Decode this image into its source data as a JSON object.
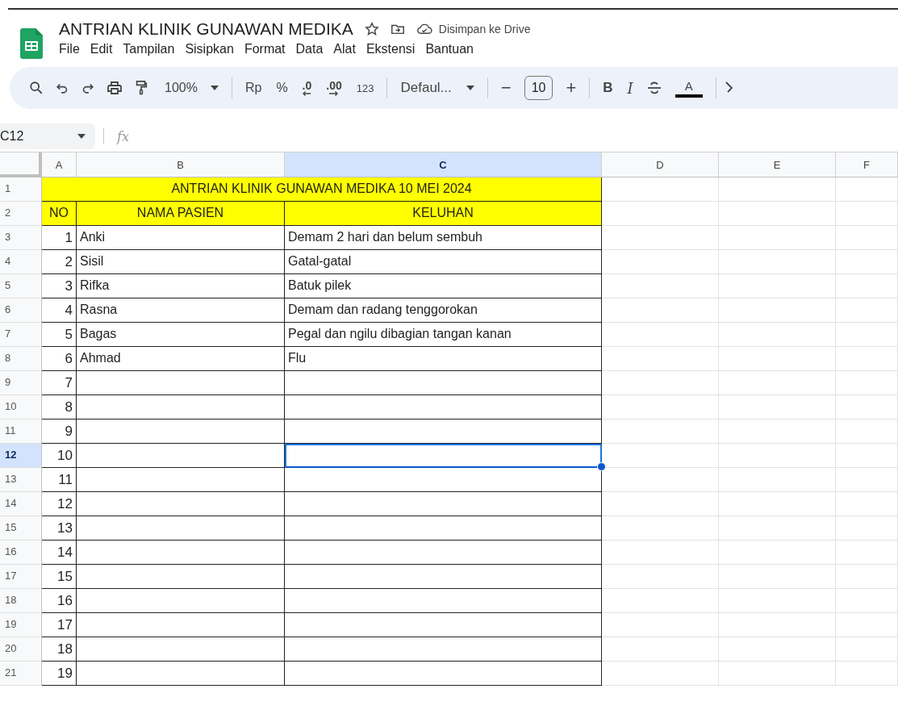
{
  "document": {
    "title": "ANTRIAN KLINIK GUNAWAN MEDIKA",
    "save_status": "Disimpan ke Drive"
  },
  "menu": [
    "File",
    "Edit",
    "Tampilan",
    "Sisipkan",
    "Format",
    "Data",
    "Alat",
    "Ekstensi",
    "Bantuan"
  ],
  "toolbar": {
    "zoom": "100%",
    "currency": "Rp",
    "percent": "%",
    "decrease_decimal": ".0",
    "increase_decimal": ".00",
    "number_format": "123",
    "font": "Defaul...",
    "minus": "−",
    "font_size": "10",
    "plus": "+",
    "bold": "B",
    "italic": "I",
    "text_color": "A"
  },
  "name_box": "C12",
  "formula_label": "fx",
  "columns": [
    {
      "label": "A",
      "selected": false
    },
    {
      "label": "B",
      "selected": false
    },
    {
      "label": "C",
      "selected": true
    },
    {
      "label": "D",
      "selected": false
    },
    {
      "label": "E",
      "selected": false
    },
    {
      "label": "F",
      "selected": false
    }
  ],
  "rows": [
    {
      "number": "1",
      "selected": false,
      "kind": "title",
      "text": "ANTRIAN KLINIK GUNAWAN MEDIKA 10 MEI 2024"
    },
    {
      "number": "2",
      "selected": false,
      "kind": "header",
      "cells": [
        "NO",
        "NAMA PASIEN",
        "KELUHAN"
      ]
    },
    {
      "number": "3",
      "selected": false,
      "kind": "data",
      "cells": [
        "1",
        "Anki",
        "Demam 2 hari dan belum sembuh"
      ]
    },
    {
      "number": "4",
      "selected": false,
      "kind": "data",
      "cells": [
        "2",
        "Sisil",
        "Gatal-gatal"
      ]
    },
    {
      "number": "5",
      "selected": false,
      "kind": "data",
      "cells": [
        "3",
        "Rifka",
        "Batuk pilek"
      ]
    },
    {
      "number": "6",
      "selected": false,
      "kind": "data",
      "cells": [
        "4",
        "Rasna",
        "Demam dan radang tenggorokan"
      ]
    },
    {
      "number": "7",
      "selected": false,
      "kind": "data",
      "cells": [
        "5",
        "Bagas",
        "Pegal dan ngilu dibagian tangan kanan"
      ]
    },
    {
      "number": "8",
      "selected": false,
      "kind": "data",
      "cells": [
        "6",
        "Ahmad",
        "Flu"
      ]
    },
    {
      "number": "9",
      "selected": false,
      "kind": "data",
      "cells": [
        "7"
      ]
    },
    {
      "number": "10",
      "selected": false,
      "kind": "data",
      "cells": [
        "8"
      ]
    },
    {
      "number": "11",
      "selected": false,
      "kind": "data",
      "cells": [
        "9"
      ]
    },
    {
      "number": "12",
      "selected": true,
      "kind": "data",
      "cells": [
        "10"
      ]
    },
    {
      "number": "13",
      "selected": false,
      "kind": "data",
      "cells": [
        "11"
      ]
    },
    {
      "number": "14",
      "selected": false,
      "kind": "data",
      "cells": [
        "12"
      ]
    },
    {
      "number": "15",
      "selected": false,
      "kind": "data",
      "cells": [
        "13"
      ]
    },
    {
      "number": "16",
      "selected": false,
      "kind": "data",
      "cells": [
        "14"
      ]
    },
    {
      "number": "17",
      "selected": false,
      "kind": "data",
      "cells": [
        "15"
      ]
    },
    {
      "number": "18",
      "selected": false,
      "kind": "data",
      "cells": [
        "16"
      ]
    },
    {
      "number": "19",
      "selected": false,
      "kind": "data",
      "cells": [
        "17"
      ]
    },
    {
      "number": "20",
      "selected": false,
      "kind": "data",
      "cells": [
        "18"
      ]
    },
    {
      "number": "21",
      "selected": false,
      "kind": "data",
      "cells": [
        "19"
      ]
    }
  ]
}
